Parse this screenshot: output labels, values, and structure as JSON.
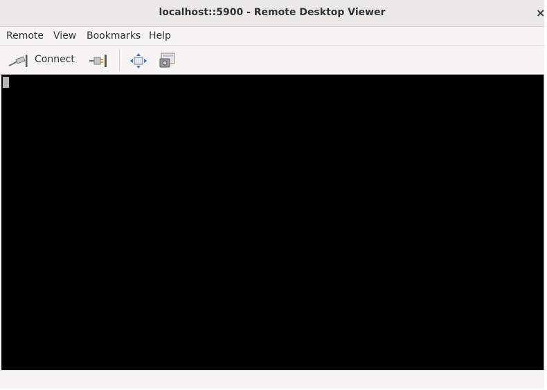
{
  "window": {
    "title": "localhost::5900 - Remote Desktop Viewer",
    "close_glyph": "×"
  },
  "menubar": {
    "items": [
      {
        "label": "Remote"
      },
      {
        "label": "View"
      },
      {
        "label": "Bookmarks"
      },
      {
        "label": "Help"
      }
    ]
  },
  "toolbar": {
    "connect_label": "Connect",
    "icons": [
      "connect-plug-icon",
      "disconnect-plug-icon",
      "fit-view-icon",
      "screenshot-icon"
    ]
  },
  "remote_view": {
    "background": "#000000"
  },
  "statusbar": {
    "text": ""
  }
}
